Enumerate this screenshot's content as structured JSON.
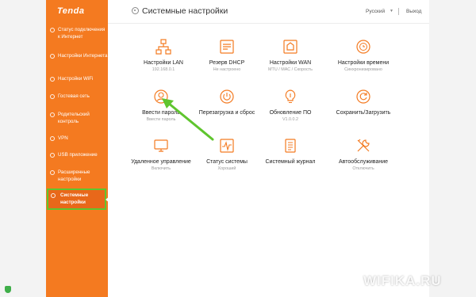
{
  "app": {
    "logo": "Tenda",
    "accent": "#f47a20",
    "highlight": "#5fc52e"
  },
  "header": {
    "title": "Системные настройки",
    "language": "Русский",
    "logout": "Выход"
  },
  "sidebar": {
    "items": [
      {
        "label": "Статус подключения к Интернет",
        "icon": "globe-icon"
      },
      {
        "label": "Настройки Интернета",
        "icon": "globe-icon"
      },
      {
        "label": "Настройки WiFi",
        "icon": "wifi-icon"
      },
      {
        "label": "Гостевая сеть",
        "icon": "guest-icon"
      },
      {
        "label": "Родительский контроль",
        "icon": "parental-icon"
      },
      {
        "label": "VPN",
        "icon": "vpn-icon"
      },
      {
        "label": "USB приложение",
        "icon": "usb-icon"
      },
      {
        "label": "Расширенные настройки",
        "icon": "advanced-icon"
      },
      {
        "label": "Системные настройки",
        "icon": "gear-icon",
        "active": true
      }
    ]
  },
  "tiles": [
    {
      "label": "Настройки LAN",
      "sub": "192.168.0.1",
      "icon": "lan-icon"
    },
    {
      "label": "Резерв DHCP",
      "sub": "Не настроено",
      "icon": "dhcp-icon"
    },
    {
      "label": "Настройки WAN",
      "sub": "MTU / MAC / Скорость",
      "icon": "wan-icon"
    },
    {
      "label": "Настройки времени",
      "sub": "Синхронизировано",
      "icon": "clock-icon"
    },
    {
      "label": "Ввести пароль",
      "sub": "Ввести пароль",
      "icon": "password-icon"
    },
    {
      "label": "Перезагрузка и сброс",
      "sub": "",
      "icon": "reboot-icon"
    },
    {
      "label": "Обновление ПО",
      "sub": "V1.0.0.2",
      "icon": "firmware-icon"
    },
    {
      "label": "Сохранить/Загрузить",
      "sub": "",
      "icon": "backup-icon"
    },
    {
      "label": "Удаленное управление",
      "sub": "Включить",
      "icon": "remote-icon"
    },
    {
      "label": "Статус системы",
      "sub": "Хороший",
      "icon": "status-icon"
    },
    {
      "label": "Системный журнал",
      "sub": "",
      "icon": "log-icon"
    },
    {
      "label": "Автообслуживание",
      "sub": "Отключить",
      "icon": "maintenance-icon"
    }
  ],
  "watermark": "WIFIKA.RU"
}
